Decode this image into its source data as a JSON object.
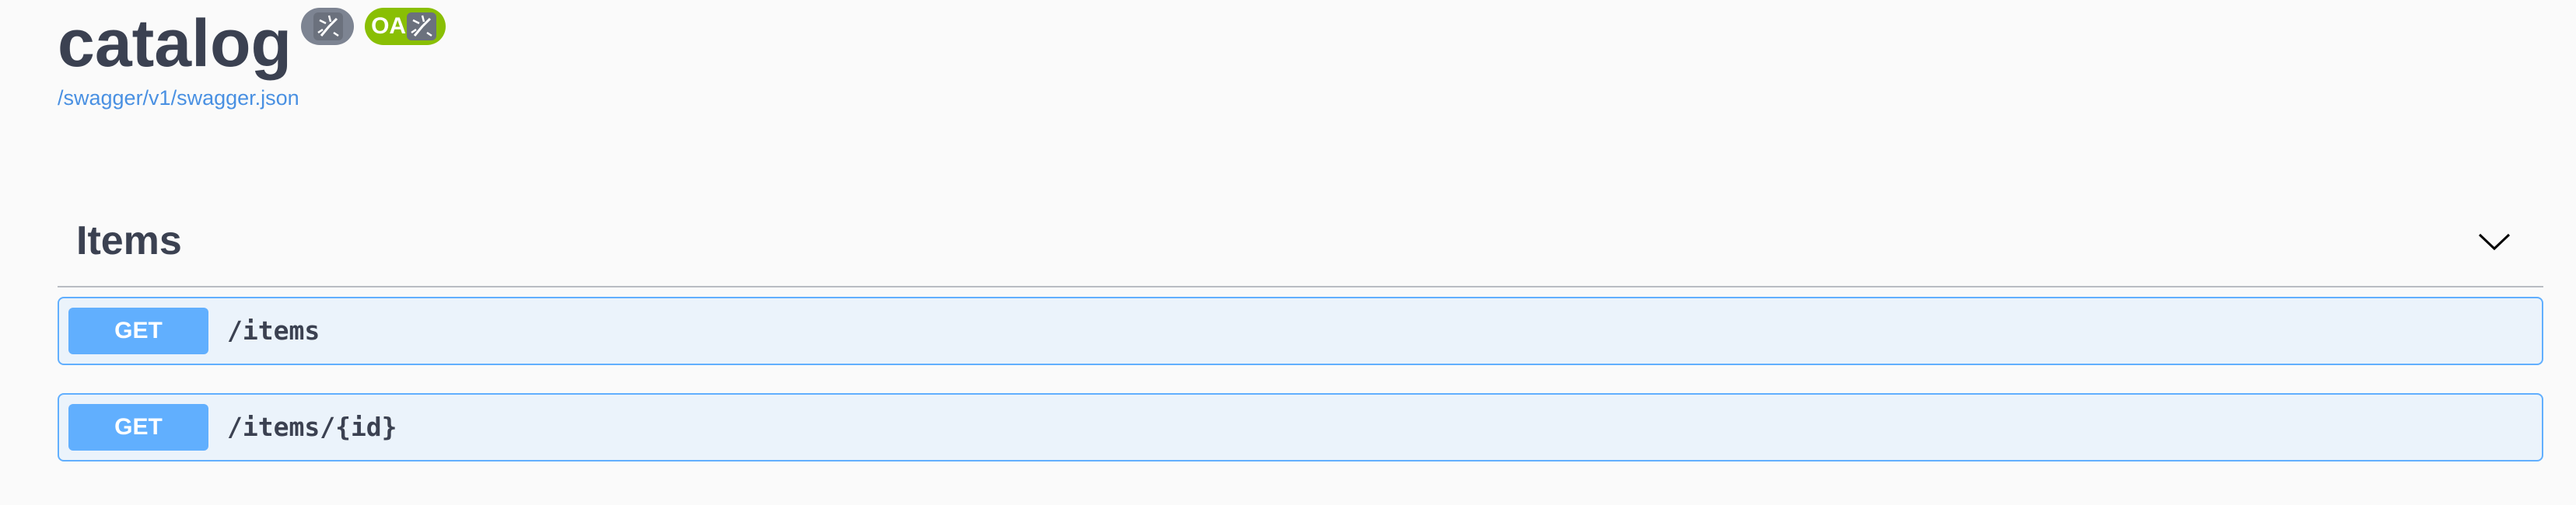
{
  "info": {
    "title": "catalog",
    "version_badge": {
      "icon": "swagger-stamp-icon",
      "color": "#7d8492"
    },
    "oas_badge": {
      "text": "OAS",
      "icon": "swagger-stamp-icon",
      "color": "#89bf04"
    },
    "spec_url": "/swagger/v1/swagger.json"
  },
  "tag": {
    "name": "Items",
    "toggle_icon": "chevron-down-icon",
    "operations": [
      {
        "method": "GET",
        "path": "/items",
        "color": "#61affe"
      },
      {
        "method": "GET",
        "path": "/items/{id}",
        "color": "#61affe"
      }
    ]
  }
}
